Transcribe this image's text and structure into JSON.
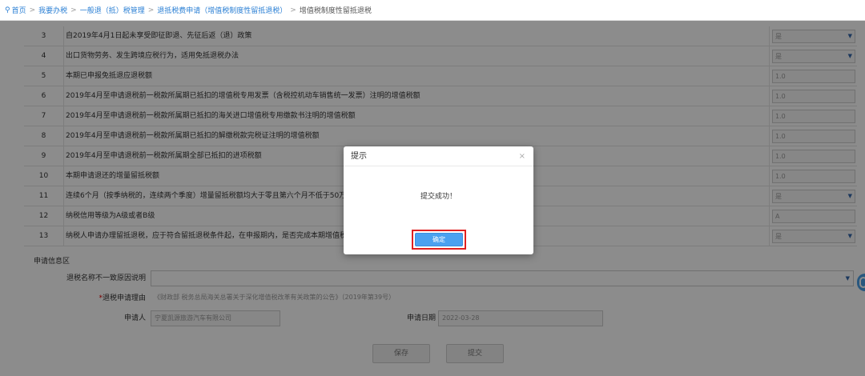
{
  "breadcrumb": {
    "items": [
      "首页",
      "我要办税",
      "一般退（抵）税管理",
      "退抵税费申请（增值税制度性留抵退税）",
      "增值税制度性留抵退税"
    ],
    "separator": ">"
  },
  "table": {
    "rows": [
      {
        "num": "3",
        "label": "自2019年4月1日起未享受即征即退、先征后返（退）政策",
        "value": "是",
        "dropdown": true
      },
      {
        "num": "4",
        "label": "出口货物劳务、发生跨境应税行为，适用免抵退税办法",
        "value": "是",
        "dropdown": true
      },
      {
        "num": "5",
        "label": "本期已申报免抵退应退税额",
        "value": "1.0",
        "dropdown": false
      },
      {
        "num": "6",
        "label": "2019年4月至申请退税前一税款所属期已抵扣的增值税专用发票（含税控机动车销售统一发票）注明的增值税额",
        "value": "1.0",
        "dropdown": false
      },
      {
        "num": "7",
        "label": "2019年4月至申请退税前一税款所属期已抵扣的海关进口增值税专用缴款书注明的增值税额",
        "value": "1.0",
        "dropdown": false
      },
      {
        "num": "8",
        "label": "2019年4月至申请退税前一税款所属期已抵扣的解缴税款完税证注明的增值税额",
        "value": "1.0",
        "dropdown": false
      },
      {
        "num": "9",
        "label": "2019年4月至申请退税前一税款所属期全部已抵扣的进项税额",
        "value": "1.0",
        "dropdown": false
      },
      {
        "num": "10",
        "label": "本期申请退还的增量留抵税额",
        "value": "1.0",
        "dropdown": false
      },
      {
        "num": "11",
        "label": "连续6个月（按季纳税的，连续两个季度）增量留抵税额均大于零且第六个月不低于50万元的超",
        "value": "是",
        "dropdown": true
      },
      {
        "num": "12",
        "label": "纳税信用等级为A级或者B级",
        "value": "A",
        "dropdown": false
      },
      {
        "num": "13",
        "label": "纳税人申请办理留抵退税，应于符合留抵退税条件起，在申报期内，是否完成本期增值税纳税申",
        "value": "是",
        "dropdown": true
      }
    ]
  },
  "form": {
    "section_title": "申请信息区",
    "mismatch_label": "退税名称不一致原因说明",
    "mismatch_value": "",
    "reason_required_mark": "*",
    "reason_label": "退税申请理由",
    "reason_value": "《财政部 税务总局海关总署关于深化增值税改革有关政策的公告》（2019年第39号）",
    "applicant_label": "申请人",
    "applicant_value": "宁夏凯源旅游汽车有限公司",
    "date_label": "申请日期",
    "date_value": "2022-03-28"
  },
  "buttons": {
    "save": "保存",
    "submit": "提交"
  },
  "dialog": {
    "title": "提示",
    "close": "×",
    "message": "提交成功！",
    "ok": "确定"
  },
  "icons": {
    "caret": "▼",
    "pin": "location-pin-icon"
  },
  "colors": {
    "link": "#2a7fd4",
    "primary": "#4aa1f0",
    "highlight": "#e02020",
    "overlay": "rgba(0,0,0,0.45)"
  }
}
